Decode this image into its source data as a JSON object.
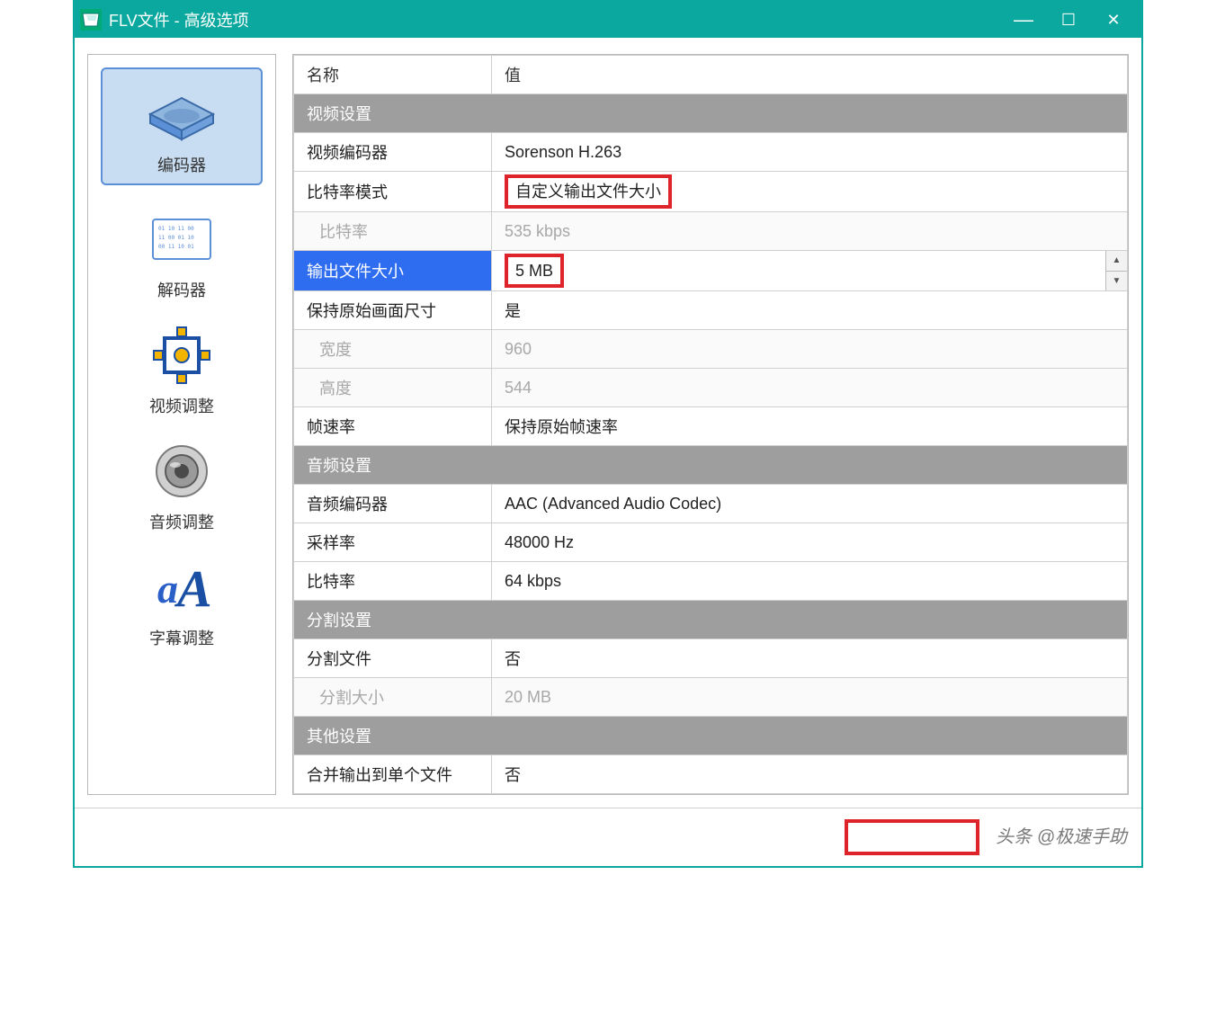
{
  "window": {
    "title": "FLV文件 - 高级选项",
    "minimize": "—",
    "maximize": "☐",
    "close": "✕"
  },
  "sidebar": {
    "items": [
      {
        "label": "编码器"
      },
      {
        "label": "解码器"
      },
      {
        "label": "视频调整"
      },
      {
        "label": "音频调整"
      },
      {
        "label": "字幕调整"
      }
    ]
  },
  "table": {
    "header_name": "名称",
    "header_value": "值",
    "sections": {
      "video": "视频设置",
      "audio": "音频设置",
      "split": "分割设置",
      "other": "其他设置"
    },
    "rows": {
      "video_encoder_k": "视频编码器",
      "video_encoder_v": "Sorenson H.263",
      "bitrate_mode_k": "比特率模式",
      "bitrate_mode_v": "自定义输出文件大小",
      "bitrate_k": "比特率",
      "bitrate_v": "535 kbps",
      "out_size_k": "输出文件大小",
      "out_size_v": "5 MB",
      "keep_orig_k": "保持原始画面尺寸",
      "keep_orig_v": "是",
      "width_k": "宽度",
      "width_v": "960",
      "height_k": "高度",
      "height_v": "544",
      "fps_k": "帧速率",
      "fps_v": "保持原始帧速率",
      "audio_encoder_k": "音频编码器",
      "audio_encoder_v": "AAC (Advanced Audio Codec)",
      "sample_k": "采样率",
      "sample_v": "48000 Hz",
      "abitrate_k": "比特率",
      "abitrate_v": "64 kbps",
      "splitfile_k": "分割文件",
      "splitfile_v": "否",
      "splitsize_k": "分割大小",
      "splitsize_v": "20 MB",
      "merge_k": "合并输出到单个文件",
      "merge_v": "否"
    }
  },
  "footer": {
    "watermark": "头条 @极速手助"
  }
}
